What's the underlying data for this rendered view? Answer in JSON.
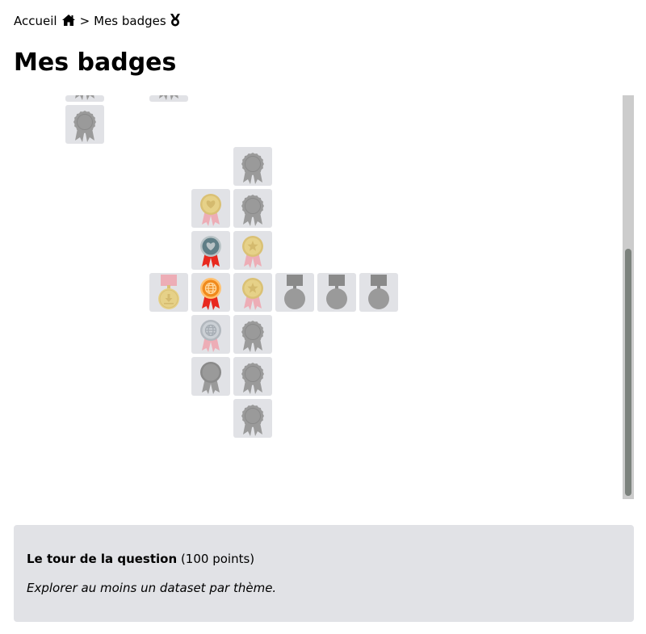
{
  "breadcrumb": {
    "home_label": "Accueil",
    "separator": ">",
    "current_label": "Mes badges",
    "home_icon": "home-icon",
    "current_icon": "medal-icon"
  },
  "page": {
    "title": "Mes badges"
  },
  "colors": {
    "tile_bg": "#e1e2e6",
    "locked_badge": "#9a9a9a",
    "gold": "#e8cf78",
    "pale_gold": "#ebd8a6",
    "bronze_orange": "#f08a1c",
    "silver": "#c8cdd3",
    "steel_blue": "#5f7e86",
    "ribbon_red": "#e8281e",
    "ribbon_pink": "#f0a4ae",
    "scrollbar_track": "#cccccc",
    "scrollbar_thumb": "#7c827d"
  },
  "badges": [
    {
      "id": "b01",
      "col": 0,
      "row": 0,
      "style": "rosette",
      "state": "locked",
      "emblem": "none",
      "partial": true
    },
    {
      "id": "b02",
      "col": 2,
      "row": 0,
      "style": "rosette",
      "state": "locked",
      "emblem": "none",
      "partial": true
    },
    {
      "id": "b03",
      "col": 0,
      "row": 1,
      "style": "rosette",
      "state": "locked",
      "emblem": "none"
    },
    {
      "id": "b04",
      "col": 4,
      "row": 2,
      "style": "rosette",
      "state": "locked",
      "emblem": "none"
    },
    {
      "id": "b05",
      "col": 3,
      "row": 3,
      "style": "ribbon-medal",
      "state": "gold-faded",
      "emblem": "heart-icon"
    },
    {
      "id": "b06",
      "col": 4,
      "row": 3,
      "style": "rosette",
      "state": "locked",
      "emblem": "none"
    },
    {
      "id": "b07",
      "col": 3,
      "row": 4,
      "style": "ribbon-medal",
      "state": "steel",
      "emblem": "heart-icon"
    },
    {
      "id": "b08",
      "col": 4,
      "row": 4,
      "style": "ribbon-medal",
      "state": "gold-faded",
      "emblem": "star-icon"
    },
    {
      "id": "b09",
      "col": 2,
      "row": 5,
      "style": "hanging-medal",
      "state": "gold-faded",
      "emblem": "download-icon"
    },
    {
      "id": "b10",
      "col": 3,
      "row": 5,
      "style": "ribbon-medal",
      "state": "bronze",
      "emblem": "globe-icon"
    },
    {
      "id": "b11",
      "col": 4,
      "row": 5,
      "style": "ribbon-medal",
      "state": "gold-faded",
      "emblem": "star-icon"
    },
    {
      "id": "b12",
      "col": 5,
      "row": 5,
      "style": "hanging-medal",
      "state": "locked",
      "emblem": "none"
    },
    {
      "id": "b13",
      "col": 6,
      "row": 5,
      "style": "hanging-medal",
      "state": "locked",
      "emblem": "none"
    },
    {
      "id": "b14",
      "col": 7,
      "row": 5,
      "style": "hanging-medal",
      "state": "locked",
      "emblem": "none"
    },
    {
      "id": "b15",
      "col": 3,
      "row": 6,
      "style": "ribbon-medal",
      "state": "silver-faded",
      "emblem": "globe-icon"
    },
    {
      "id": "b16",
      "col": 4,
      "row": 6,
      "style": "rosette",
      "state": "locked",
      "emblem": "none"
    },
    {
      "id": "b17",
      "col": 3,
      "row": 7,
      "style": "ribbon-medal",
      "state": "locked",
      "emblem": "none"
    },
    {
      "id": "b18",
      "col": 4,
      "row": 7,
      "style": "rosette",
      "state": "locked",
      "emblem": "none"
    },
    {
      "id": "b19",
      "col": 4,
      "row": 8,
      "style": "rosette",
      "state": "locked",
      "emblem": "none"
    }
  ],
  "selected_badge": {
    "name": "Le tour de la question",
    "points": "(100 points)",
    "description": "Explorer au moins un dataset par thème."
  }
}
